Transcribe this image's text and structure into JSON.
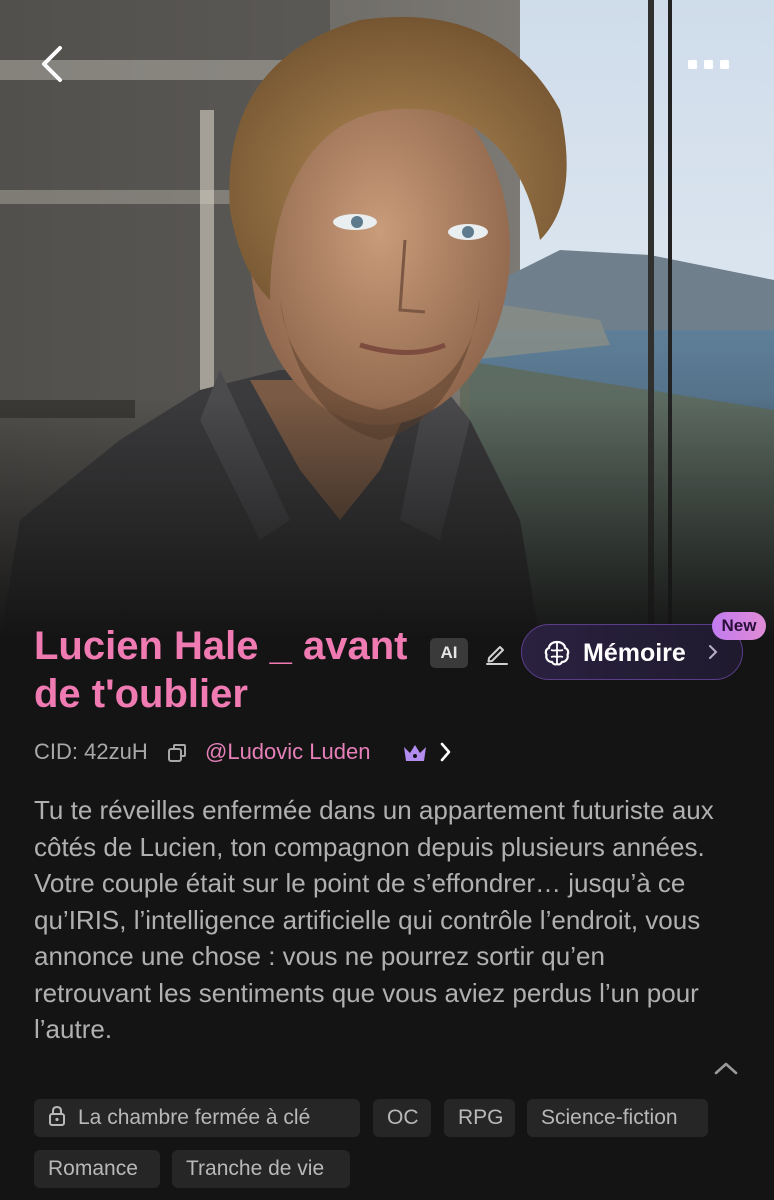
{
  "header": {
    "back_icon": "chevron-left-icon",
    "more_icon": "more-dots-icon"
  },
  "character": {
    "name": "Lucien Hale _ avant de t'oublier",
    "ai_badge": "AI",
    "cid": "CID: 42zuH",
    "author": "@Ludovic Luden",
    "description": "Tu te réveilles enfermée dans un appartement futuriste aux côtés de Lucien, ton compagnon depuis plusieurs années. Votre couple était sur le point de s’effondrer… jusqu’à ce qu’IRIS, l’intelligence artificielle qui contrôle l’endroit, vous annonce une chose : vous ne pourrez sortir qu’en retrouvant les sentiments que vous aviez perdus l’un pour l’autre."
  },
  "memory": {
    "label": "Mémoire",
    "new_badge": "New"
  },
  "tags": [
    "La chambre fermée à clé",
    "OC",
    "RPG",
    "Science-fiction",
    "Romance",
    "Tranche de vie"
  ],
  "colors": {
    "background": "#141414",
    "title_pink": "#f07bb2",
    "author_pink": "#e680b8",
    "memory_border": "#5b3d8a",
    "new_badge": "#d487e2",
    "tag_bg": "#262626"
  }
}
